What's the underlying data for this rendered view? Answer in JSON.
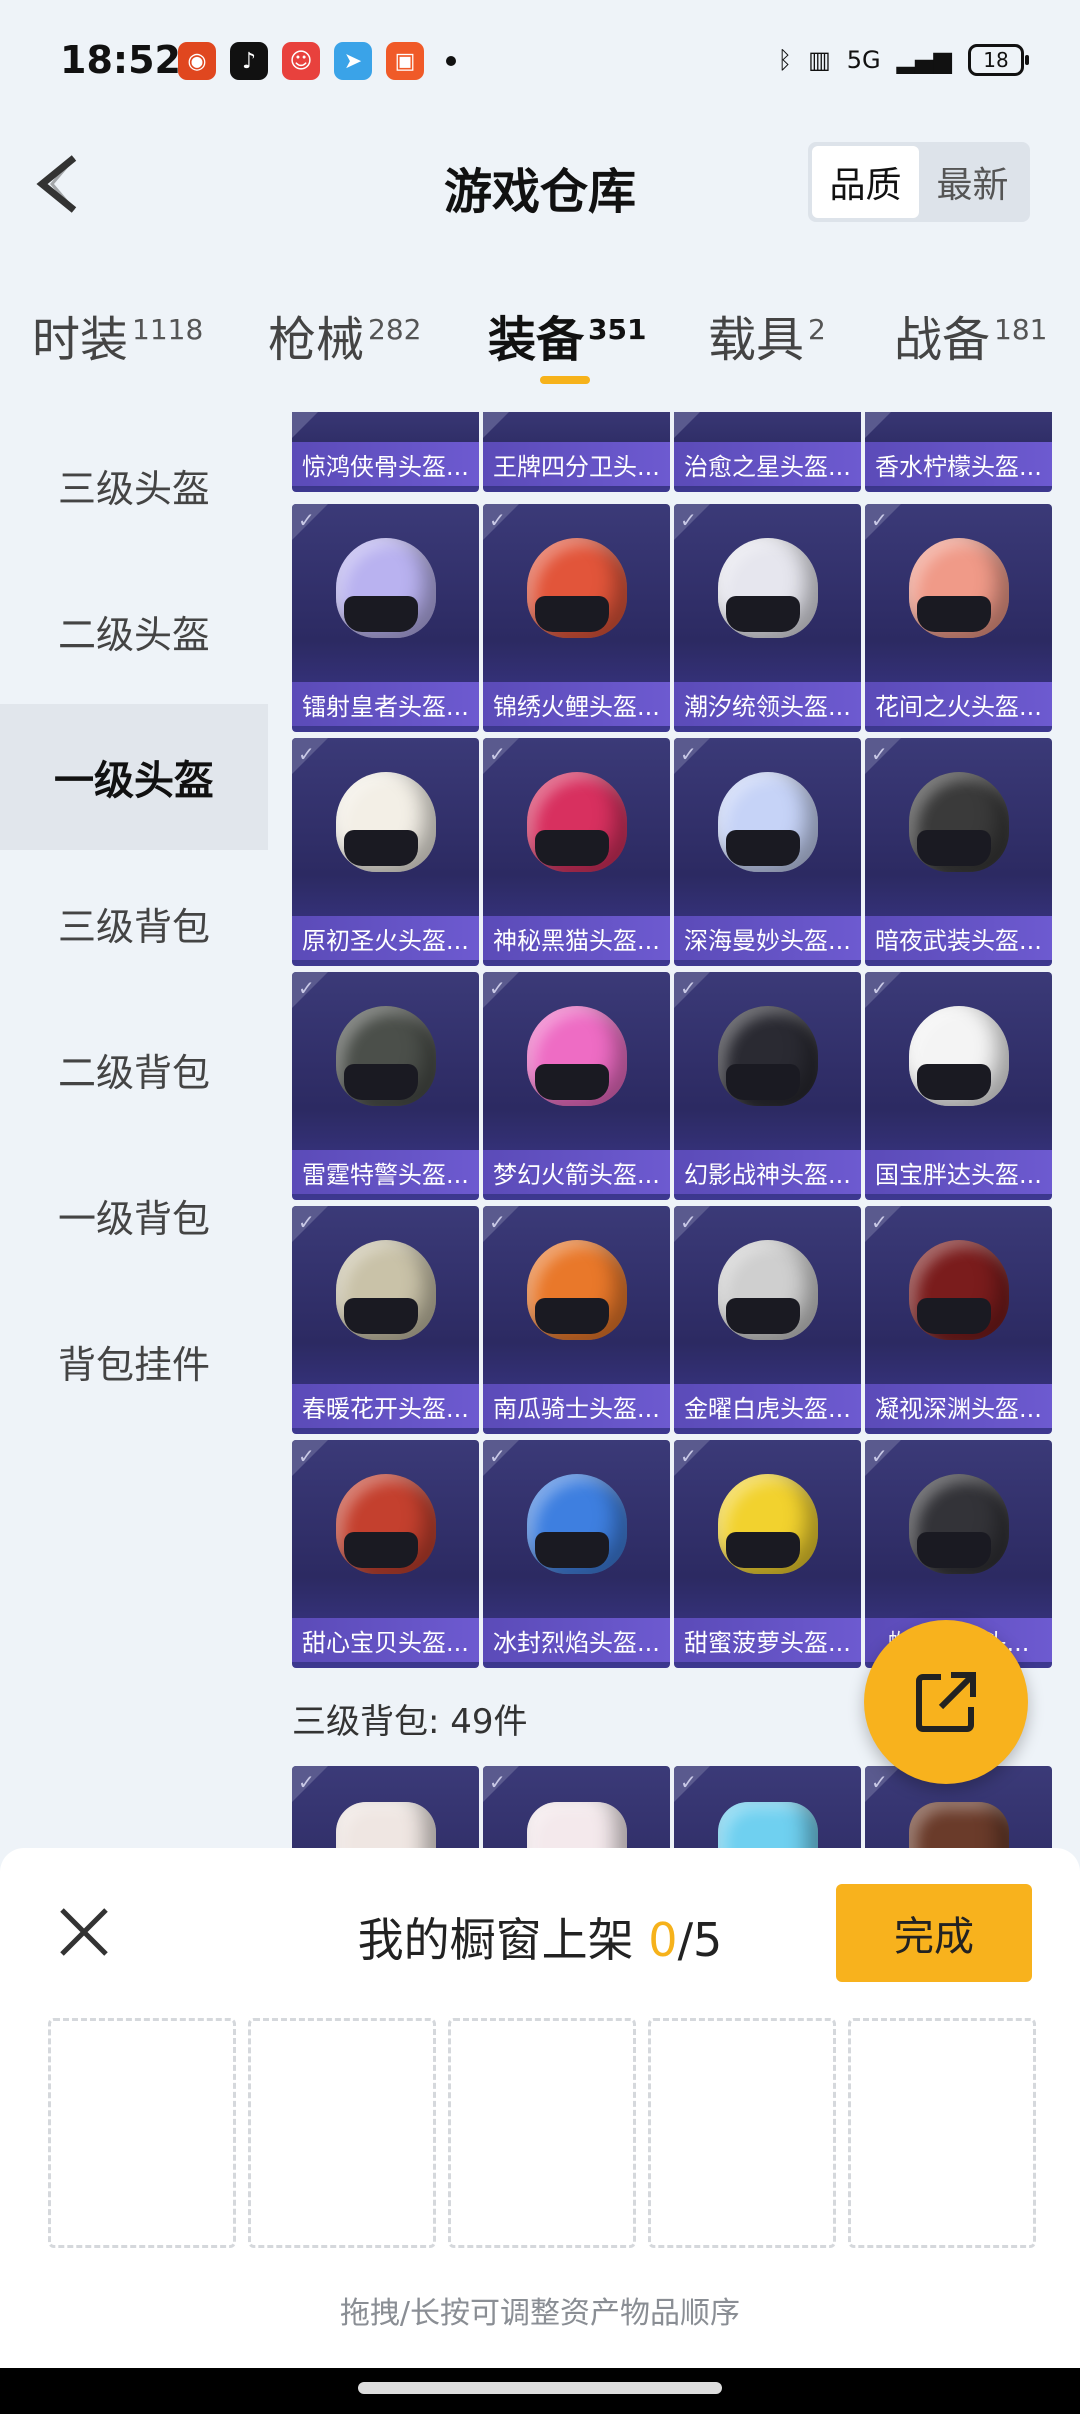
{
  "status_bar": {
    "time": "18:52",
    "battery": "18",
    "network": "5G"
  },
  "header": {
    "title": "游戏仓库",
    "sort": {
      "quality": "品质",
      "newest": "最新",
      "selected": "品质"
    }
  },
  "categories": [
    {
      "label": "时装",
      "count": "1118"
    },
    {
      "label": "枪械",
      "count": "282"
    },
    {
      "label": "装备",
      "count": "351",
      "active": true
    },
    {
      "label": "载具",
      "count": "2"
    },
    {
      "label": "战备",
      "count": "181"
    }
  ],
  "sidebar": {
    "items": [
      "三级头盔",
      "二级头盔",
      "一级头盔",
      "三级背包",
      "二级背包",
      "一级背包",
      "背包挂件"
    ],
    "active": "一级头盔"
  },
  "items": {
    "partial_row": [
      "惊鸿侠骨头盔...",
      "王牌四分卫头...",
      "治愈之星头盔...",
      "香水柠檬头盔..."
    ],
    "rows": [
      [
        {
          "label": "镭射皇者头盔...",
          "color": "#b9b2f0"
        },
        {
          "label": "锦绣火鲤头盔...",
          "color": "#e2553a"
        },
        {
          "label": "潮汐统领头盔...",
          "color": "#e6e6ee"
        },
        {
          "label": "花间之火头盔...",
          "color": "#f09a88"
        }
      ],
      [
        {
          "label": "原初圣火头盔...",
          "color": "#f3efe6"
        },
        {
          "label": "神秘黑猫头盔...",
          "color": "#d8305f"
        },
        {
          "label": "深海曼妙头盔...",
          "color": "#c6d3f7"
        },
        {
          "label": "暗夜武装头盔...",
          "color": "#3a3a3a"
        }
      ],
      [
        {
          "label": "雷霆特警头盔...",
          "color": "#4b4f4a"
        },
        {
          "label": "梦幻火箭头盔...",
          "color": "#ee6cc4"
        },
        {
          "label": "幻影战神头盔...",
          "color": "#2a2a32"
        },
        {
          "label": "国宝胖达头盔...",
          "color": "#f4f4f4"
        }
      ],
      [
        {
          "label": "春暖花开头盔...",
          "color": "#c9c2a8"
        },
        {
          "label": "南瓜骑士头盔...",
          "color": "#e9782a"
        },
        {
          "label": "金曜白虎头盔...",
          "color": "#cfcfcf"
        },
        {
          "label": "凝视深渊头盔...",
          "color": "#7a1c1c"
        }
      ],
      [
        {
          "label": "甜心宝贝头盔...",
          "color": "#c4402e"
        },
        {
          "label": "冰封烈焰头盔...",
          "color": "#3e7fe0"
        },
        {
          "label": "甜蜜菠萝头盔...",
          "color": "#f2d22e"
        },
        {
          "label": "蜘蛛...者头...",
          "color": "#333338"
        }
      ]
    ],
    "section_title": "三级背包: 49件"
  },
  "showcase": {
    "title": "我的橱窗上架",
    "count": "0",
    "total": "/5",
    "done_label": "完成",
    "hint": "拖拽/长按可调整资产物品顺序",
    "slots": 5
  },
  "colors": {
    "accent": "#f8b21d",
    "card_bg": "#2c2a62",
    "label_bg": "#5b4bb8"
  }
}
